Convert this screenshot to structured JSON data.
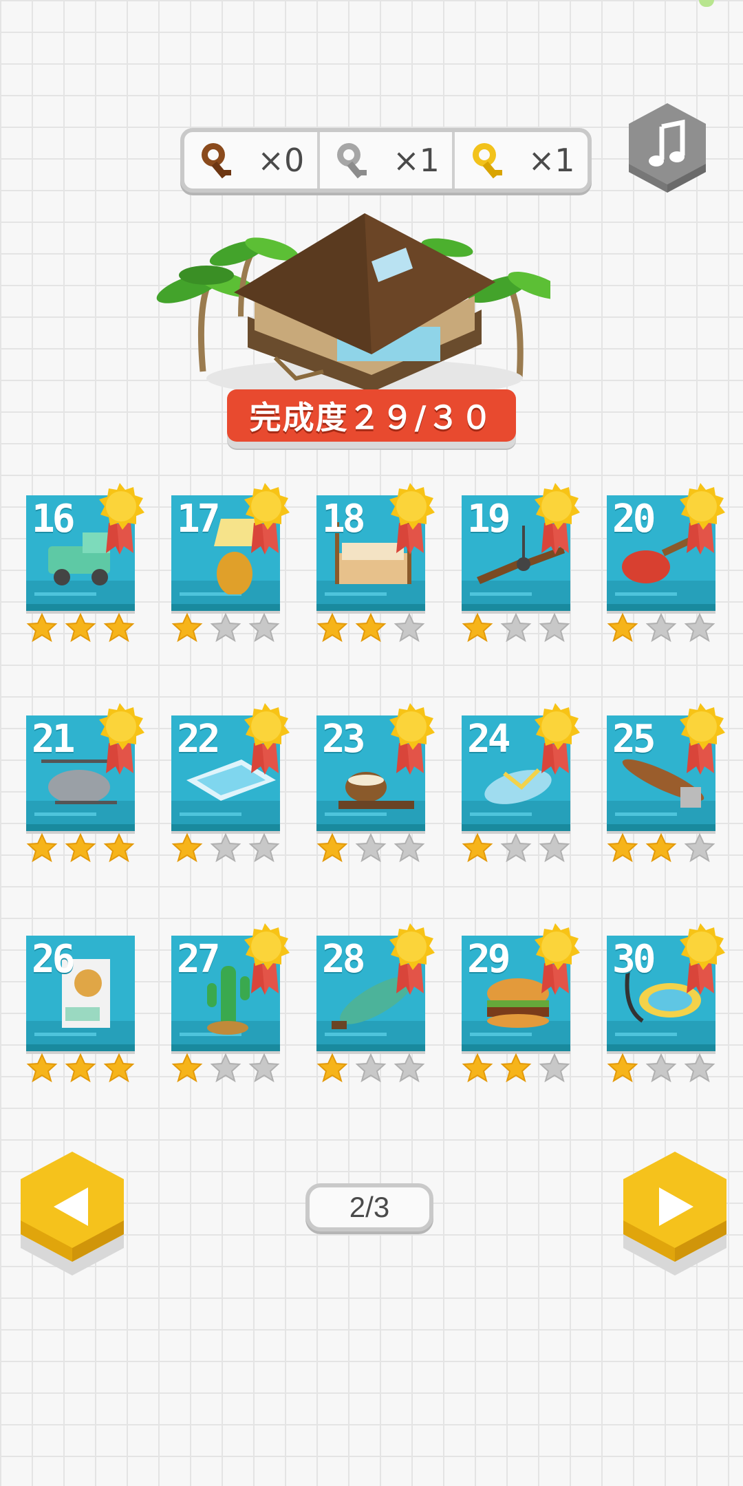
{
  "keys": [
    {
      "name": "bronze-key",
      "count": "×0",
      "color": "#8a4a1c"
    },
    {
      "name": "silver-key",
      "count": "×1",
      "color": "#9e9e9e"
    },
    {
      "name": "gold-key",
      "count": "×1",
      "color": "#f2c21b"
    }
  ],
  "progress_text": "完成度２９/３０",
  "levels": [
    {
      "num": "16",
      "stars": 3,
      "medal": true,
      "item": "truck-icon"
    },
    {
      "num": "17",
      "stars": 1,
      "medal": true,
      "item": "pineapple-lamp-icon"
    },
    {
      "num": "18",
      "stars": 2,
      "medal": true,
      "item": "bed-icon"
    },
    {
      "num": "19",
      "stars": 1,
      "medal": true,
      "item": "ceiling-fan-icon"
    },
    {
      "num": "20",
      "stars": 1,
      "medal": true,
      "item": "ukulele-icon"
    },
    {
      "num": "21",
      "stars": 3,
      "medal": true,
      "item": "helicopter-icon"
    },
    {
      "num": "22",
      "stars": 1,
      "medal": true,
      "item": "pool-icon"
    },
    {
      "num": "23",
      "stars": 1,
      "medal": true,
      "item": "coconut-drink-icon"
    },
    {
      "num": "24",
      "stars": 1,
      "medal": true,
      "item": "flip-flop-icon"
    },
    {
      "num": "25",
      "stars": 2,
      "medal": true,
      "item": "surfboard-icon"
    },
    {
      "num": "26",
      "stars": 3,
      "medal": false,
      "item": "clock-cabinet-icon"
    },
    {
      "num": "27",
      "stars": 1,
      "medal": true,
      "item": "cactus-icon"
    },
    {
      "num": "28",
      "stars": 1,
      "medal": true,
      "item": "bottle-icon"
    },
    {
      "num": "29",
      "stars": 2,
      "medal": true,
      "item": "burger-icon"
    },
    {
      "num": "30",
      "stars": 1,
      "medal": true,
      "item": "snorkel-mask-icon"
    }
  ],
  "page_indicator": "2/3",
  "colors": {
    "tile": "#2fb3cf",
    "star_on": "#f6b41a",
    "star_off": "#c8c8c8",
    "banner": "#e84a2f",
    "nav": "#f5c21c"
  }
}
